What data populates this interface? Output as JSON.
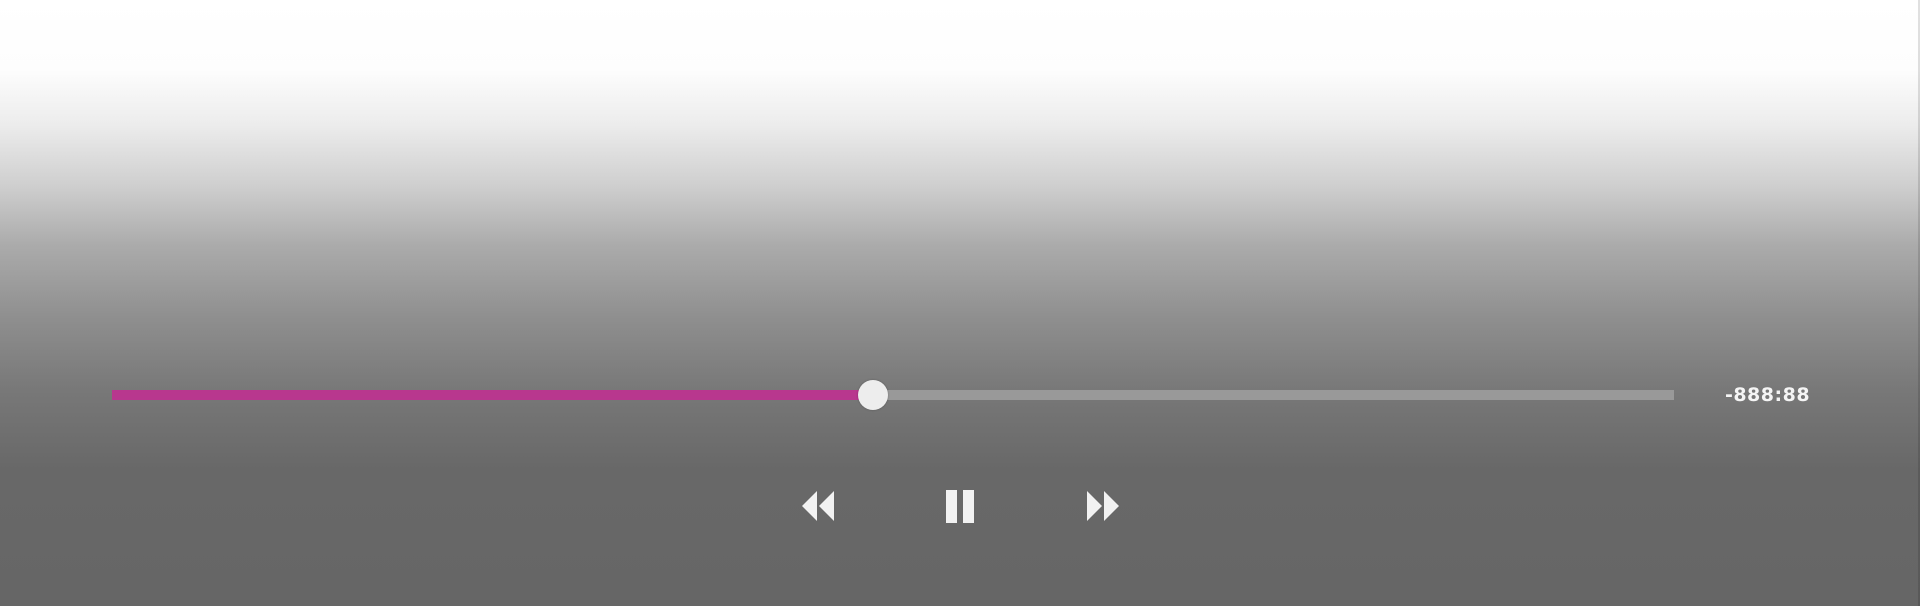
{
  "player": {
    "time_remaining": "-888:88",
    "progress_fraction": 0.487,
    "played_color": "#b8378e",
    "track_color": "#999999",
    "thumb_color": "#ededed"
  },
  "controls": {
    "rewind_icon": "rewind-icon",
    "pause_icon": "pause-icon",
    "forward_icon": "fast-forward-icon"
  }
}
